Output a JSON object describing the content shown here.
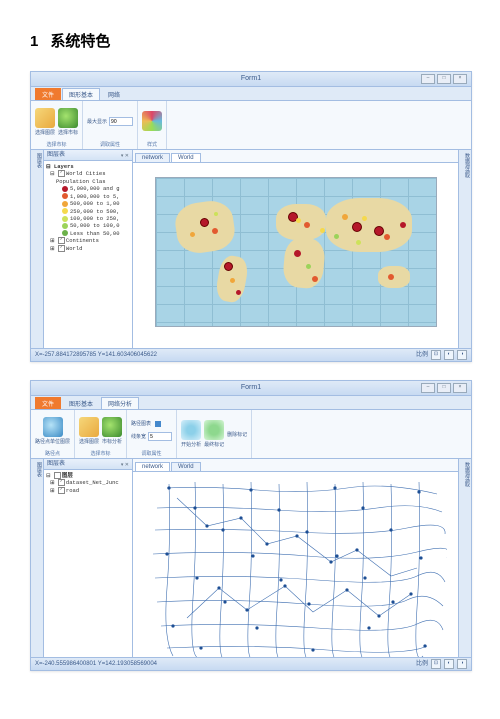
{
  "section": {
    "number": "1",
    "title": "系统特色"
  },
  "window1": {
    "title": "Form1",
    "ribbon": {
      "tabs": {
        "file": "文件",
        "t1": "图形基本",
        "t2": "网络"
      },
      "groups": {
        "g1": {
          "btn1": "选择图层",
          "btn2": "选择市标",
          "label": "选择市标"
        },
        "g2": {
          "field1_label": "最大显示",
          "field1_value": "90",
          "label": "调取属性"
        },
        "g3": {
          "btn1": "",
          "label": "样式"
        }
      }
    },
    "toc": {
      "title": "图层表",
      "root": "Layers",
      "items": [
        "World Cities",
        "Population Clas",
        "5,000,000 and g",
        "1,000,000 to 5,",
        "500,000 to 1,00",
        "250,000 to 500,",
        "100,000 to 250,",
        "50,000 to 100,0",
        "Less than 50,00",
        "Continents",
        "World"
      ]
    },
    "docTabs": {
      "t1": "network",
      "t2": "World"
    },
    "rightPanel": "数据源选取",
    "status": {
      "coords": "X=-257.884172895785  Y=141.603406045622",
      "scale": "比例"
    }
  },
  "window2": {
    "title": "Form1",
    "ribbon": {
      "tabs": {
        "file": "文件",
        "t1": "图形基本",
        "t2": "网络分析"
      },
      "groups": {
        "g1": {
          "btn1": "路径点单位图层",
          "label": "路径点"
        },
        "g2": {
          "btn1": "选择图层",
          "btn2": "市标分析",
          "label": "选择市标"
        },
        "g3": {
          "field1_label": "路径图表",
          "field2_label": "线条宽",
          "field2_value": "5",
          "label": "调取属性"
        },
        "g4": {
          "btn1": "开始分析",
          "btn2": "最终标记",
          "btn3": "删除标记",
          "label": ""
        }
      }
    },
    "toc": {
      "title": "图层表",
      "root": "图层",
      "items": [
        "dataset_Net_Junc",
        "road"
      ]
    },
    "docTabs": {
      "t1": "network",
      "t2": "World"
    },
    "rightPanel": "数据源选取",
    "status": {
      "coords": "X=-240.555986400801  Y=142.193058569004",
      "scale": "比例"
    }
  }
}
